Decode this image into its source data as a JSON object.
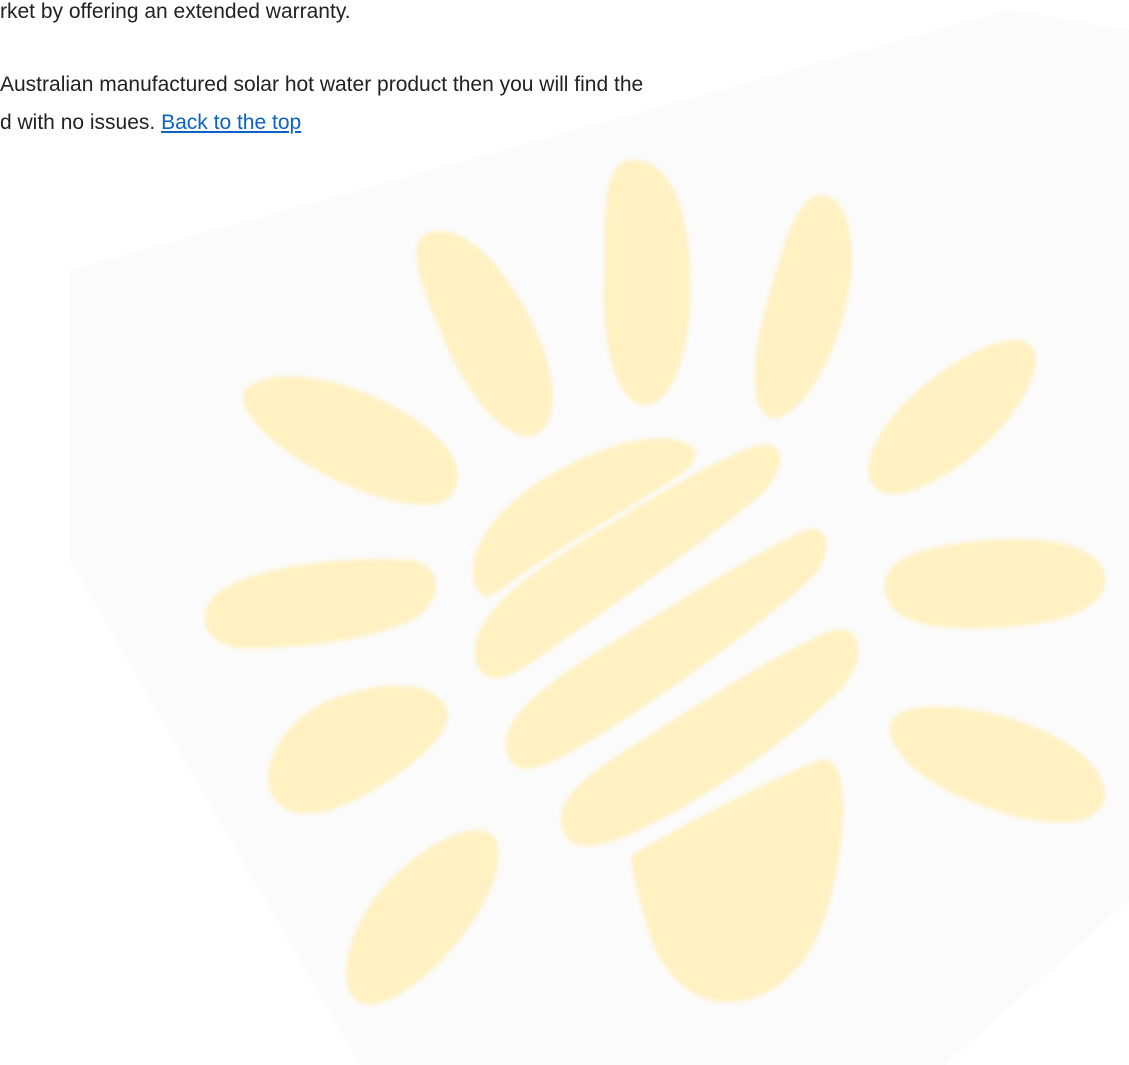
{
  "document": {
    "line_1": "rket by offering an extended warranty.",
    "line_2": "Australian manufactured solar hot water product then you will find the",
    "line_3_text": "d with no issues. ",
    "back_to_top_link": "Back to the top"
  },
  "colors": {
    "text": "#222222",
    "link": "#0b63c4",
    "watermark_petal": "#fff1c2",
    "watermark_backdrop": "#fbfbfb"
  },
  "watermark": {
    "icon": "sun-logo-watermark"
  }
}
